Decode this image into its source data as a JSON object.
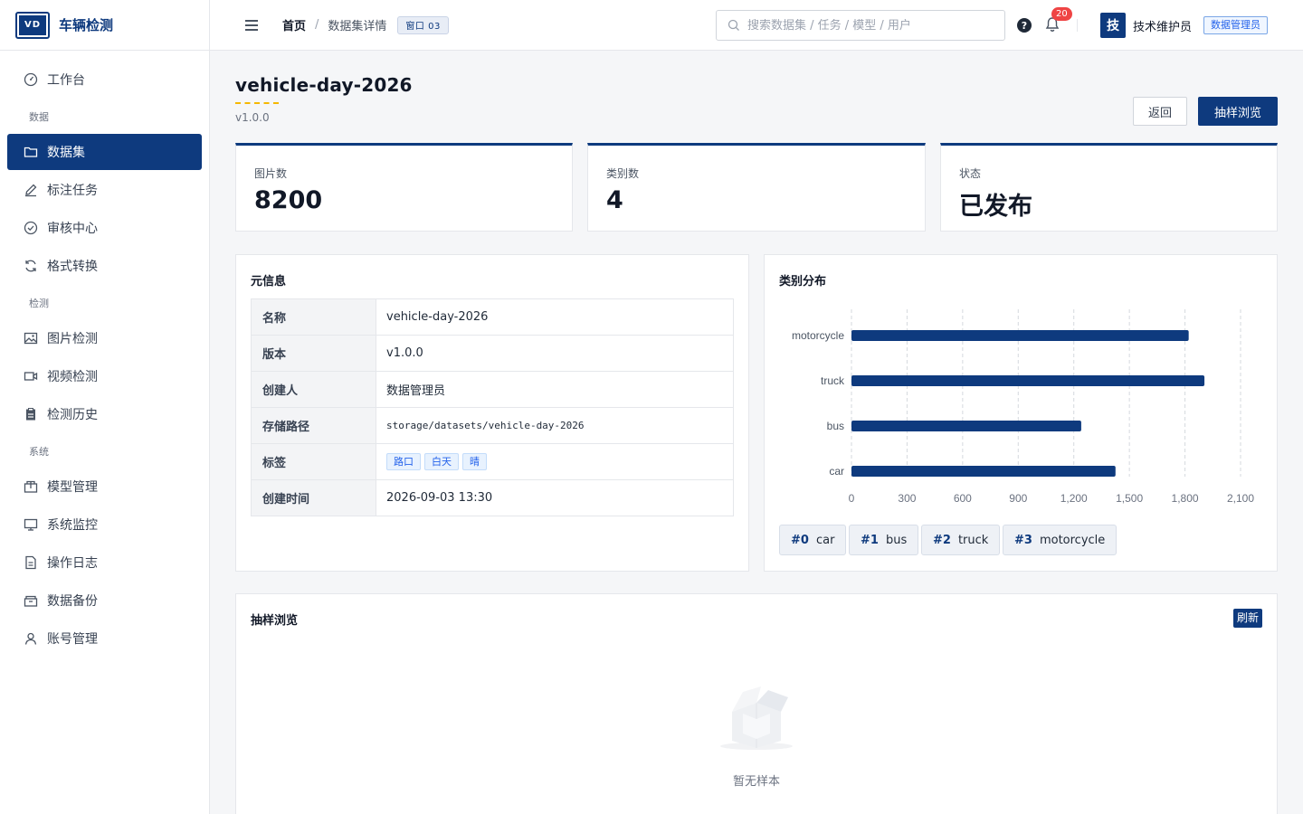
{
  "app": {
    "logo_text": "VD",
    "name": "车辆检测"
  },
  "sidebar": {
    "items": [
      {
        "label": "工作台",
        "icon": "dashboard-icon"
      },
      {
        "group": "数据"
      },
      {
        "label": "数据集",
        "icon": "folder-icon",
        "active": true
      },
      {
        "label": "标注任务",
        "icon": "pencil-icon"
      },
      {
        "label": "审核中心",
        "icon": "check-circle-icon"
      },
      {
        "label": "格式转换",
        "icon": "refresh-icon"
      },
      {
        "group": "检测"
      },
      {
        "label": "图片检测",
        "icon": "image-icon"
      },
      {
        "label": "视频检测",
        "icon": "video-icon"
      },
      {
        "label": "检测历史",
        "icon": "clipboard-icon"
      },
      {
        "group": "系统"
      },
      {
        "label": "模型管理",
        "icon": "box-icon"
      },
      {
        "label": "系统监控",
        "icon": "monitor-icon"
      },
      {
        "label": "操作日志",
        "icon": "document-icon"
      },
      {
        "label": "数据备份",
        "icon": "archive-icon"
      },
      {
        "label": "账号管理",
        "icon": "user-icon"
      }
    ]
  },
  "header": {
    "breadcrumb_home": "首页",
    "breadcrumb_sep": "/",
    "breadcrumb_current": "数据集详情",
    "window_badge": "窗口 03",
    "search_placeholder": "搜索数据集 / 任务 / 模型 / 用户",
    "help_label": "?",
    "notification_count": "20",
    "avatar_char": "技",
    "username": "技术维护员",
    "role": "数据管理员"
  },
  "page": {
    "title": "vehicle-day-2026",
    "version": "v1.0.0",
    "back_label": "返回",
    "sample_label": "抽样浏览"
  },
  "stats": [
    {
      "label": "图片数",
      "value": "8200"
    },
    {
      "label": "类别数",
      "value": "4"
    },
    {
      "label": "状态",
      "value": "已发布"
    }
  ],
  "meta": {
    "title": "元信息",
    "rows": [
      {
        "key": "名称",
        "value": "vehicle-day-2026"
      },
      {
        "key": "版本",
        "value": "v1.0.0"
      },
      {
        "key": "创建人",
        "value": "数据管理员"
      },
      {
        "key": "存储路径",
        "value": "storage/datasets/vehicle-day-2026"
      },
      {
        "key": "标签",
        "value": ""
      },
      {
        "key": "创建时间",
        "value": "2026-09-03 13:30"
      }
    ],
    "tags": [
      "路口",
      "白天",
      "晴"
    ]
  },
  "distribution": {
    "title": "类别分布",
    "chips": [
      {
        "id": "#0",
        "name": "car"
      },
      {
        "id": "#1",
        "name": "bus"
      },
      {
        "id": "#2",
        "name": "truck"
      },
      {
        "id": "#3",
        "name": "motorcycle"
      }
    ]
  },
  "chart_data": {
    "type": "bar",
    "orientation": "horizontal",
    "categories": [
      "motorcycle",
      "truck",
      "bus",
      "car"
    ],
    "values": [
      1820,
      1905,
      1240,
      1425
    ],
    "xlim": [
      0,
      2100
    ],
    "xticks": [
      "0",
      "300",
      "600",
      "900",
      "1,200",
      "1,500",
      "1,800",
      "2,100"
    ],
    "grid": "vertical dashed",
    "color": "#0e3a7e"
  },
  "sample": {
    "title": "抽样浏览",
    "refresh_label": "刷新",
    "empty_text": "暂无样本"
  },
  "colors": {
    "primary": "#0e3a7e",
    "accent": "#f5b800",
    "badge_red": "#ef4444"
  }
}
